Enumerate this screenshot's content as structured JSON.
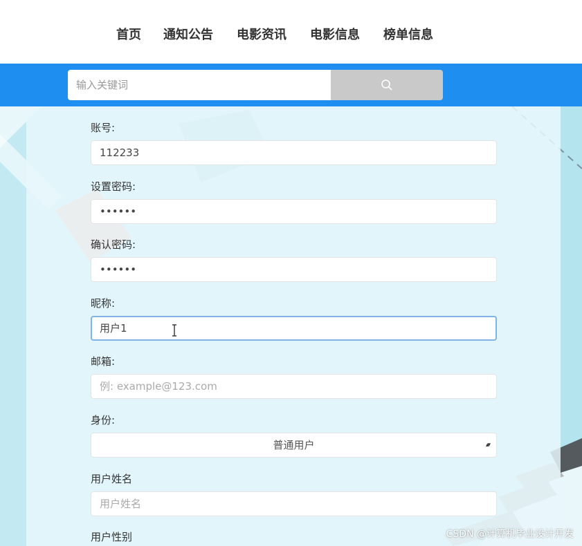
{
  "nav": {
    "items": [
      {
        "label": "首页"
      },
      {
        "label": "通知公告"
      },
      {
        "label": "电影资讯"
      },
      {
        "label": "电影信息"
      },
      {
        "label": "榜单信息"
      }
    ]
  },
  "search": {
    "placeholder": "输入关键词",
    "button_icon": "search-icon"
  },
  "form": {
    "account": {
      "label": "账号:",
      "value": "112233"
    },
    "password": {
      "label": "设置密码:",
      "value": "••••••"
    },
    "confirm_password": {
      "label": "确认密码:",
      "value": "••••••"
    },
    "nickname": {
      "label": "昵称:",
      "value": "用户1"
    },
    "email": {
      "label": "邮箱:",
      "placeholder": "例: example@123.com"
    },
    "identity": {
      "label": "身份:",
      "selected": "普通用户"
    },
    "real_name": {
      "label": "用户姓名",
      "placeholder": "用户姓名"
    },
    "gender": {
      "label": "用户性别"
    }
  },
  "watermark": "CSDN @计算机毕业设计开发",
  "colors": {
    "accent": "#1e8ff0",
    "search_button": "#c9c9c9",
    "background": "#c3eaf3",
    "focus_border": "#7fb3e6"
  }
}
